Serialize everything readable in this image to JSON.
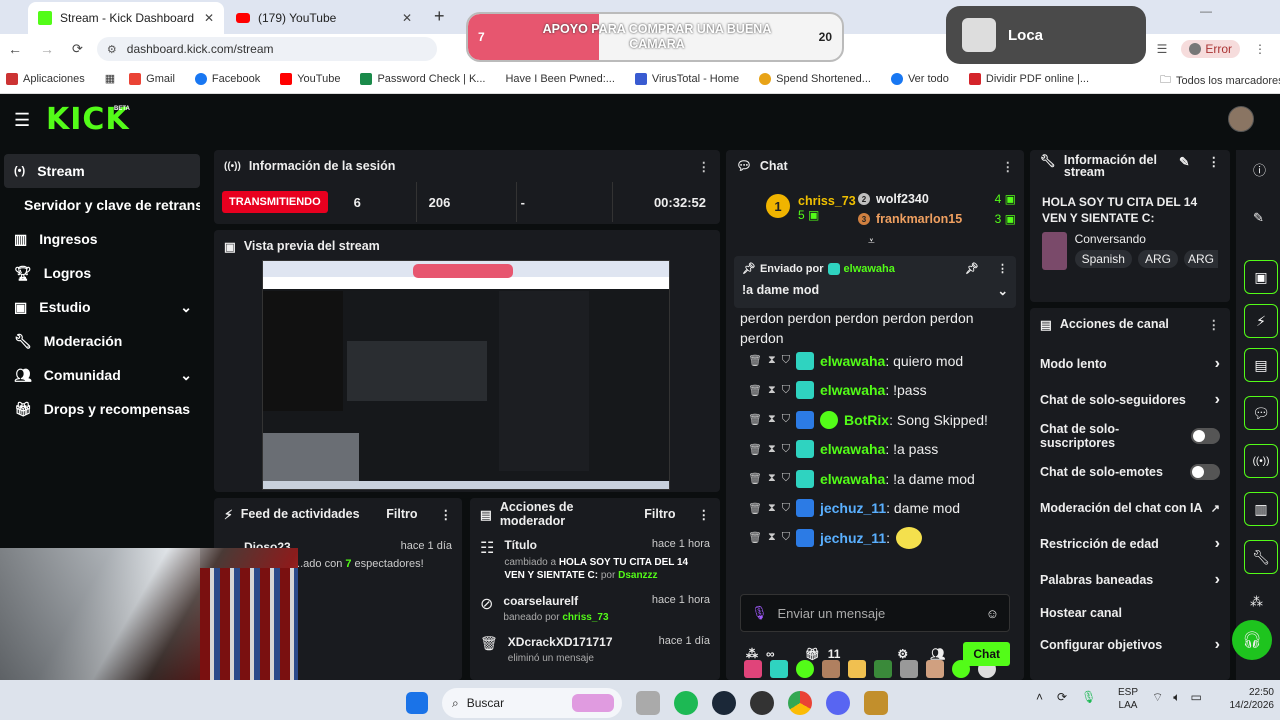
{
  "browser": {
    "tabs": [
      {
        "title": "Stream - Kick Dashboard",
        "active": true
      },
      {
        "title": "(179) YouTube",
        "active": false
      }
    ],
    "url": "dashboard.kick.com/stream",
    "bookmarks": [
      "Aplicaciones",
      "Gmail",
      "Facebook",
      "YouTube",
      "Password Check | K...",
      "Have I Been Pwned:...",
      "VirusTotal - Home",
      "Spend Shortened...",
      "Ver todo",
      "Dividir PDF online |..."
    ],
    "all_bookmarks": "Todos los marcadores",
    "error_label": "Error"
  },
  "goal": {
    "start": "7",
    "end": "20",
    "title": "APOYO PARA COMPRAR UNA BUENA CAMARA",
    "progress": 0.35
  },
  "popup": {
    "name": "Loca"
  },
  "app": {
    "logo": "KICK",
    "beta": "BETA",
    "nav": [
      {
        "label": "Stream",
        "icon": "broadcast-icon"
      },
      {
        "label": "Servidor y clave de retransm",
        "icon": ""
      },
      {
        "label": "Ingresos",
        "icon": "chart-icon"
      },
      {
        "label": "Logros",
        "icon": "trophy-icon"
      },
      {
        "label": "Estudio",
        "icon": "studio-icon",
        "chevron": true
      },
      {
        "label": "Moderación",
        "icon": "wrench-icon"
      },
      {
        "label": "Comunidad",
        "icon": "users-icon",
        "chevron": true
      },
      {
        "label": "Drops y recompensas",
        "icon": "gift-icon"
      }
    ],
    "session": {
      "title": "Información de la sesión",
      "status": "TRANSMITIENDO",
      "viewers": "6",
      "followers": "206",
      "dash": "-",
      "time": "00:32:52"
    },
    "preview": {
      "title": "Vista previa del stream"
    },
    "feed": {
      "title": "Feed de actividades",
      "filter": "Filtro",
      "item_name": "Dioso23",
      "item_time": "hace 1 día",
      "item_text_pre": "...ado con ",
      "item_count": "7",
      "item_text_post": " espectadores!"
    },
    "modactions": {
      "title": "Acciones de moderador",
      "filter": "Filtro",
      "items": [
        {
          "head": "Título",
          "time": "hace 1 hora",
          "pre": "cambiado a ",
          "bold": "HOLA SOY TU CITA DEL 14 VEN Y SIENTATE C:",
          "mid": " por ",
          "user": "Dsanzzz"
        },
        {
          "head": "coarselaurelf",
          "time": "hace 1 hora",
          "pre": "baneado por ",
          "bold": "",
          "mid": "",
          "user": "chriss_73"
        },
        {
          "head": "XDcrackXD171717",
          "time": "hace 1 día",
          "pre": "eliminó un mensaje",
          "bold": "",
          "mid": "",
          "user": ""
        }
      ]
    },
    "chat": {
      "title": "Chat",
      "leaders": [
        {
          "rank": "1",
          "name": "chriss_73",
          "count": "5"
        },
        {
          "rank": "2",
          "name": "wolf2340",
          "count": "4"
        },
        {
          "rank": "3",
          "name": "frankmarlon15",
          "count": "3"
        }
      ],
      "pinned_by_label": "Enviado por",
      "pinned_user": "elwawaha",
      "pinned_text": "!a dame mod",
      "overflow_text": "perdon perdon perdon perdon perdon perdon",
      "messages": [
        {
          "user": "elwawaha",
          "text": ": quiero mod",
          "color": "green"
        },
        {
          "user": "elwawaha",
          "text": ": !pass",
          "color": "green"
        },
        {
          "user": "BotRix",
          "text": ": Song Skipped!",
          "color": "green"
        },
        {
          "user": "elwawaha",
          "text": ": !a pass",
          "color": "green"
        },
        {
          "user": "elwawaha",
          "text": ": !a dame mod",
          "color": "green"
        },
        {
          "user": "jechuz_11",
          "text": ": dame mod",
          "color": "blue"
        },
        {
          "user": "jechuz_11",
          "text": ":",
          "color": "blue"
        }
      ],
      "placeholder": "Enviar un mensaje",
      "infinity": "∞",
      "count": "11",
      "send_label": "Chat"
    },
    "streaminfo": {
      "title": "Información del stream",
      "stream_title": "HOLA SOY TU CITA DEL 14 VEN Y SIENTATE C:",
      "category": "Conversando",
      "tags": [
        "Spanish",
        "ARG",
        "ARG"
      ]
    },
    "channel": {
      "title": "Acciones de canal",
      "rows": [
        {
          "label": "Modo lento",
          "type": "chevron"
        },
        {
          "label": "Chat de solo-seguidores",
          "type": "chevron"
        },
        {
          "label": "Chat de solo-suscriptores",
          "type": "toggle"
        },
        {
          "label": "Chat de solo-emotes",
          "type": "toggle"
        },
        {
          "label": "Moderación del chat con IA",
          "type": "external"
        },
        {
          "label": "Restricción de edad",
          "type": "chevron"
        },
        {
          "label": "Palabras baneadas",
          "type": "chevron"
        },
        {
          "label": "Hostear canal",
          "type": "none"
        },
        {
          "label": "Configurar objetivos",
          "type": "chevron"
        }
      ]
    }
  },
  "taskbar": {
    "search": "Buscar",
    "lang1": "ESP",
    "lang2": "LAA",
    "time": "22:50",
    "date": "14/2/2026"
  }
}
